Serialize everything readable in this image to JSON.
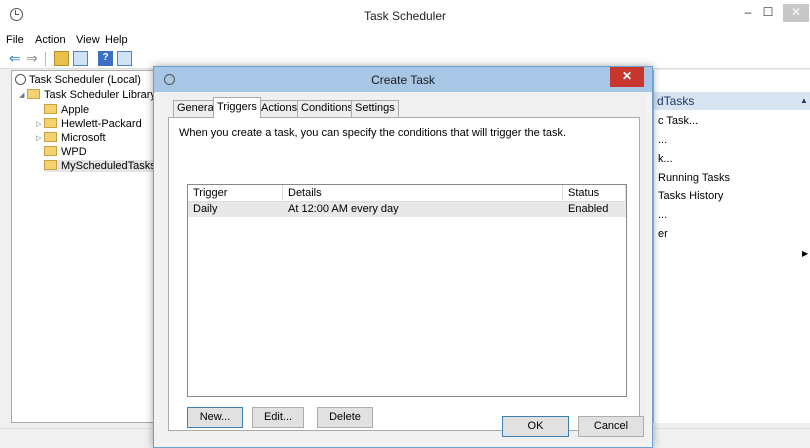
{
  "window": {
    "title": "Task Scheduler",
    "min": "–",
    "max": "☐",
    "close": "✕"
  },
  "menu": [
    "File",
    "Action",
    "View",
    "Help"
  ],
  "toolbar": {
    "back": "⇐",
    "forward": "⇒",
    "help": "?"
  },
  "tree": {
    "root": "Task Scheduler (Local)",
    "library": "Task Scheduler Library",
    "folders": [
      "Apple",
      "Hewlett-Packard",
      "Microsoft",
      "WPD",
      "MyScheduledTasks"
    ]
  },
  "actions": {
    "header": "dTasks",
    "items": [
      "c Task...",
      "...",
      "k...",
      "Running Tasks",
      "Tasks History",
      "...",
      "er",
      ""
    ]
  },
  "dialog": {
    "title": "Create Task",
    "close": "✕",
    "tabs": [
      "General",
      "Triggers",
      "Actions",
      "Conditions",
      "Settings"
    ],
    "active_tab": "Triggers",
    "instructions": "When you create a task, you can specify the conditions that will trigger the task.",
    "columns": [
      "Trigger",
      "Details",
      "Status"
    ],
    "rows": [
      {
        "trigger": "Daily",
        "details": "At 12:00 AM every day",
        "status": "Enabled"
      }
    ],
    "buttons": {
      "new": "New...",
      "edit": "Edit...",
      "delete": "Delete",
      "ok": "OK",
      "cancel": "Cancel"
    }
  }
}
